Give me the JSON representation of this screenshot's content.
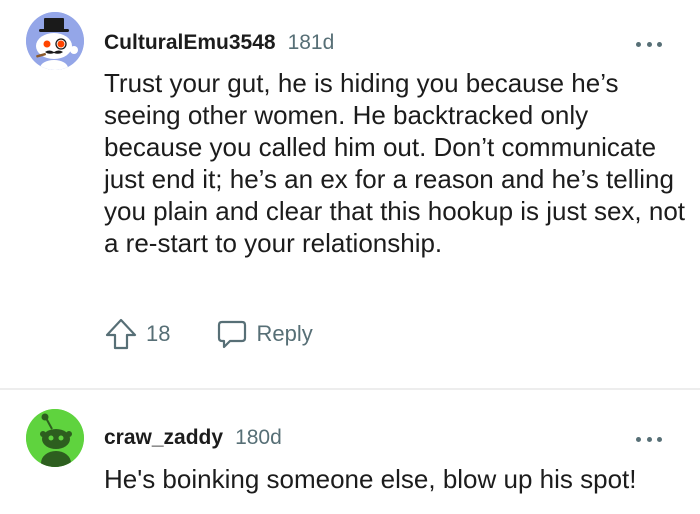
{
  "comments": [
    {
      "username": "CulturalEmu3548",
      "age": "181d",
      "avatar": "snoo-top-hat-avatar",
      "text": "Trust your gut, he is hiding you because he’s seeing other women. He backtracked only because you called him out. Don’t communicate just end it; he’s an ex for a reason and he’s telling you plain and clear that this hookup is just sex, not a re-start to your relationship.",
      "votes": "18",
      "reply_label": "Reply"
    },
    {
      "username": "craw_zaddy",
      "age": "180d",
      "avatar": "snoo-green-avatar",
      "text": "He's boinking someone else, blow up his spot!"
    }
  ],
  "colors": {
    "meta_gray": "#576f76",
    "avatar1_bg": "#94a6e8",
    "avatar2_bg": "#5fd33e",
    "divider": "#ededed"
  },
  "icons": {
    "more": "more-dots-icon",
    "upvote": "upvote-arrow-icon",
    "reply": "speech-bubble-icon"
  }
}
